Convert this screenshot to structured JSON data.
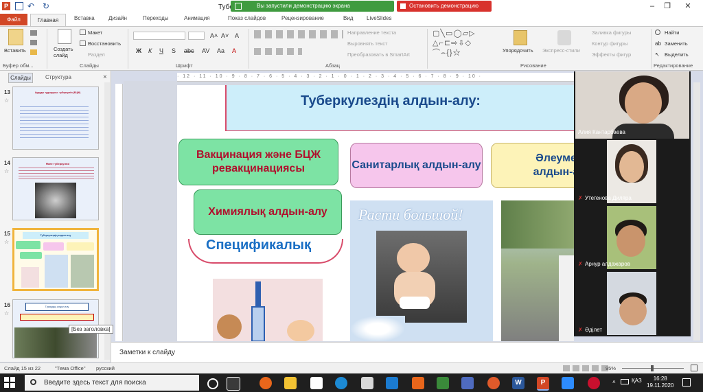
{
  "titlebar": {
    "doc_title": "Туберк",
    "share_status": "Вы запустили демонстрацию экрана",
    "stop_share": "Остановить демонстрацию",
    "minimize": "–",
    "maximize": "❐",
    "close": "✕"
  },
  "tabs": [
    "Файл",
    "Главная",
    "Вставка",
    "Дизайн",
    "Переходы",
    "Анимация",
    "Показ слайдов",
    "Рецензирование",
    "Вид",
    "LiveSlides"
  ],
  "ribbon": {
    "paste": "Вставить",
    "clipboard_group": "Буфер обм...",
    "new_slide": "Создать слайд",
    "layout": "Макет",
    "reset": "Восстановить",
    "section": "Раздел",
    "slides_group": "Слайды",
    "font_group": "Шрифт",
    "bold": "Ж",
    "italic": "К",
    "underline": "Ч",
    "strike": "S",
    "paragraph_group": "Абзац",
    "text_direction": "Направление текста",
    "align_text": "Выровнять текст",
    "smartart": "Преобразовать в SmartArt",
    "arrange": "Упорядочить",
    "quick_styles": "Экспресс-стили",
    "shape_fill": "Заливка фигуры",
    "shape_outline": "Контур фигуры",
    "shape_effects": "Эффекты фигур",
    "drawing_group": "Рисование",
    "find": "Найти",
    "replace": "Заменить",
    "select": "Выделить",
    "editing_group": "Редактирование"
  },
  "leftpane": {
    "tab_slides": "Слайды",
    "tab_outline": "Структура",
    "close": "×",
    "slides": [
      {
        "num": "13",
        "title": "Ауруды тудырушы: туберкулёз (БЦЖ)"
      },
      {
        "num": "14",
        "title": "Өкпе туберкулезі"
      },
      {
        "num": "15",
        "title": "Туберкулездің алдын-алу"
      },
      {
        "num": "16",
        "title": "Тұмаудың алдын алу"
      }
    ],
    "tooltip": "[Без заголовка]"
  },
  "ruler": "· 12 · 11 · 10 · 9 · 8 · 7 · 6 · 5 · 4 · 3 · 2 · 1 · 0 · 1 · 2 · 3 · 4 · 5 · 6 · 7 · 8 · 9 · 10 ·",
  "slide": {
    "title": "Туберкулездің алдын-алу:",
    "box_vaccination": "Вакцинация және БЦЖ ревакцинациясы",
    "box_sanitary": "Санитарлық алдын-алу",
    "box_social": "Әлеуме алдын-а",
    "box_chemical": "Химиялық алдын-алу",
    "specific": "Спецификалық",
    "photo_caption": "Расти большой!"
  },
  "participants": [
    {
      "name": "Алия Кантарбаева"
    },
    {
      "name": "Утегенова Диляра"
    },
    {
      "name": "Арнур алдажаров"
    },
    {
      "name": "Әділет"
    }
  ],
  "notes": {
    "placeholder": "Заметки к слайду"
  },
  "statusbar": {
    "slide_info": "Слайд 15 из 22",
    "theme": "\"Тема Office\"",
    "language": "русский",
    "zoom": "95%"
  },
  "taskbar": {
    "search_placeholder": "Введите здесь текст для поиска",
    "time": "16:28",
    "date": "19.11.2020",
    "lang": "ҚАЗ"
  },
  "colors": {
    "file_tab": "#d24726",
    "share_green": "#3f9b3f",
    "share_red": "#d8322d",
    "title_blue": "#1a4a8c",
    "box_green": "#7de3a4",
    "box_pink": "#f6c6ec",
    "box_yellow": "#fdf3b8"
  }
}
